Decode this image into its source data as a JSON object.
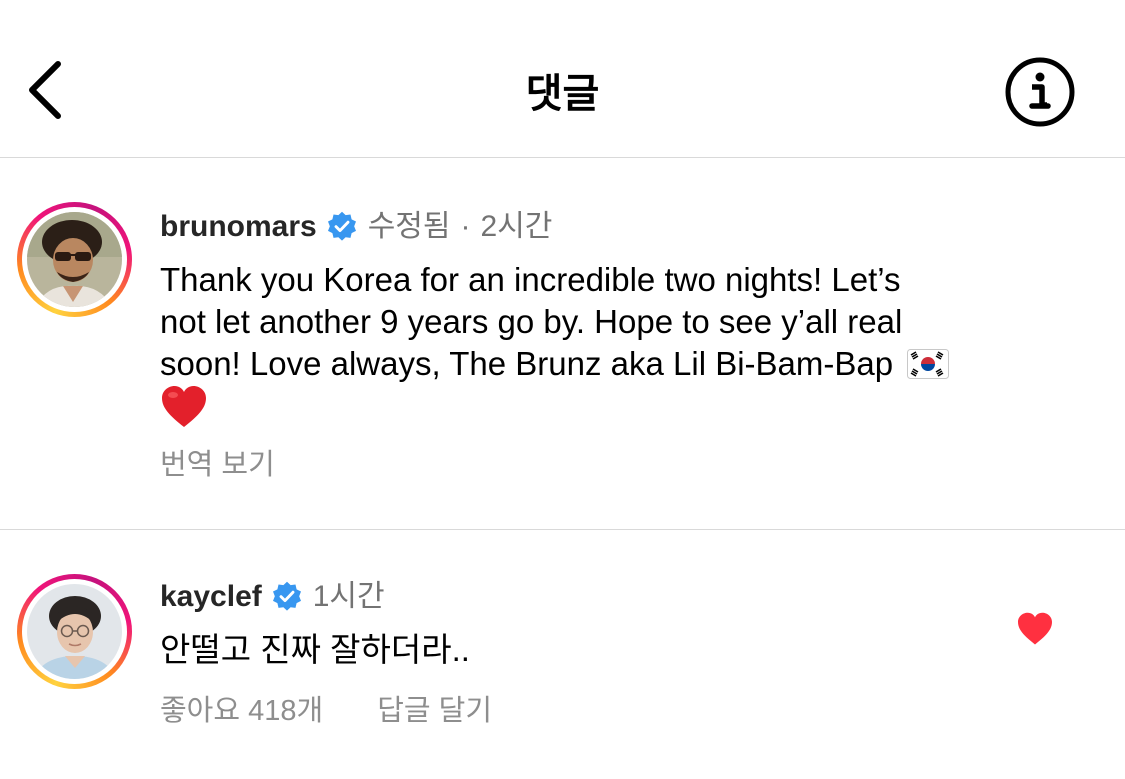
{
  "header": {
    "title": "댓글",
    "back_icon": "chevron-left-icon",
    "info_icon": "info-circle-icon"
  },
  "comments": [
    {
      "username": "brunomars",
      "verified": true,
      "edited": "수정됨",
      "separator": "·",
      "time": "2시간",
      "text_lines": [
        "Thank you Korea for an incredible two nights! Let’s",
        "not let another 9 years go by. Hope to see y’all real",
        "soon! Love always,  The Brunz aka Lil Bi-Bam-Bap"
      ],
      "emojis": [
        "south-korea-flag-emoji",
        "red-heart-emoji"
      ],
      "translate_label": "번역 보기"
    },
    {
      "username": "kayclef",
      "verified": true,
      "time": "1시간",
      "text": "안떨고 진짜 잘하더라..",
      "likes_label": "좋아요 418개",
      "reply_label": "답글 달기",
      "liked": true
    }
  ],
  "colors": {
    "verified_blue": "#3897f0",
    "like_red": "#ff3040",
    "muted_text": "#737373",
    "divider": "#d9d9d9"
  }
}
